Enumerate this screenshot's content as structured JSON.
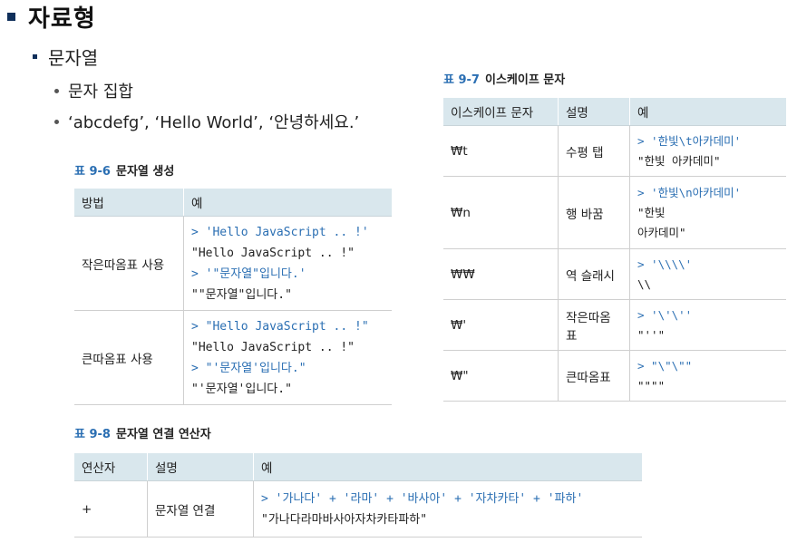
{
  "heading1": "자료형",
  "heading2": "문자열",
  "bullets": [
    "문자 집합",
    "‘abcdefg’, ‘Hello World’, ‘안녕하세요.’"
  ],
  "table96": {
    "label": "표 9-6",
    "title": "문자열 생성",
    "headers": [
      "방법",
      "예"
    ],
    "rows": [
      {
        "method": "작은따옴표 사용",
        "lines": [
          "> 'Hello JavaScript .. !'",
          "\"Hello JavaScript .. !\"",
          "> '\"문자열\"입니다.'",
          "\"\"문자열\"입니다.\""
        ]
      },
      {
        "method": "큰따옴표 사용",
        "lines": [
          "> \"Hello JavaScript .. !\"",
          "\"Hello JavaScript .. !\"",
          "> \"'문자열'입니다.\"",
          "\"'문자열'입니다.\""
        ]
      }
    ]
  },
  "table97": {
    "label": "표 9-7",
    "title": "이스케이프 문자",
    "headers": [
      "이스케이프 문자",
      "설명",
      "예"
    ],
    "rows": [
      {
        "esc": "₩t",
        "desc": "수평 탭",
        "lines": [
          "> '한빛\\t아카데미'",
          "\"한빛  아카데미\""
        ]
      },
      {
        "esc": "₩n",
        "desc": "행 바꿈",
        "lines": [
          "> '한빛\\n아카데미'",
          "\"한빛",
          "아카데미\""
        ]
      },
      {
        "esc": "₩₩",
        "desc": "역 슬래시",
        "lines": [
          "> '\\\\\\\\'",
          "\\\\"
        ]
      },
      {
        "esc": "₩'",
        "desc": "작은따옴표",
        "lines": [
          "> '\\'\\''",
          "\"''\""
        ]
      },
      {
        "esc": "₩\"",
        "desc": "큰따옴표",
        "lines": [
          "> \"\\\"\\\"\"",
          "\"\"\"\""
        ]
      }
    ]
  },
  "table98": {
    "label": "표 9-8",
    "title": "문자열 연결 연산자",
    "headers": [
      "연산자",
      "설명",
      "예"
    ],
    "rows": [
      {
        "op": "+",
        "desc": "문자열 연결",
        "lines": [
          "> '가나다' + '라마' + '바사아' + '자차카타' + '파하'",
          "\"가나다라마바사아자차카타파하\""
        ]
      }
    ]
  },
  "colors": {
    "accent": "#2b6fb3",
    "header_bg": "#d9e7ed",
    "bullet": "#0f2f5a"
  }
}
